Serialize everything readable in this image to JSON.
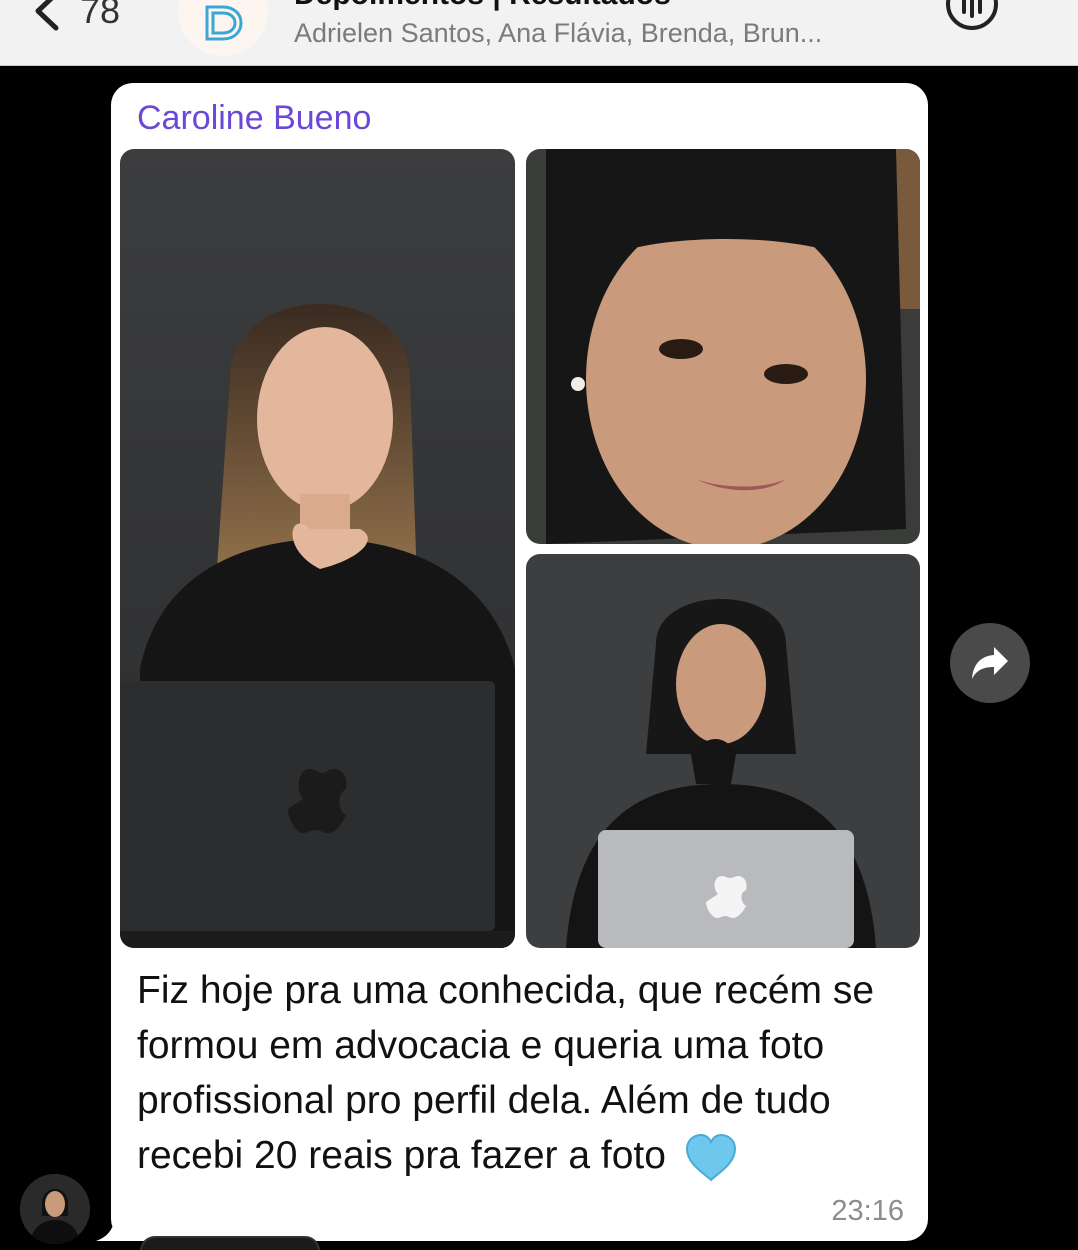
{
  "header": {
    "back_count": "78",
    "title": "Depoimentos | Resultados",
    "subtitle": "Adrielen Santos, Ana Flávia, Brenda, Brun..."
  },
  "message": {
    "sender": "Caroline Bueno",
    "text": "Fiz hoje pra uma conhecida, que recém se formou em advocacia e queria uma foto profissional pro perfil dela. Além de tudo recebi 20 reais pra fazer a foto",
    "emoji": "light-blue-heart",
    "time": "23:16"
  },
  "colors": {
    "sender_name": "#6b48d8",
    "bubble": "#ffffff",
    "background": "#000000",
    "header": "#f2f2f2"
  },
  "icons": [
    "chevron-left-icon",
    "group-logo-icon",
    "call-icon",
    "share-arrow-icon",
    "blue-heart-icon"
  ]
}
